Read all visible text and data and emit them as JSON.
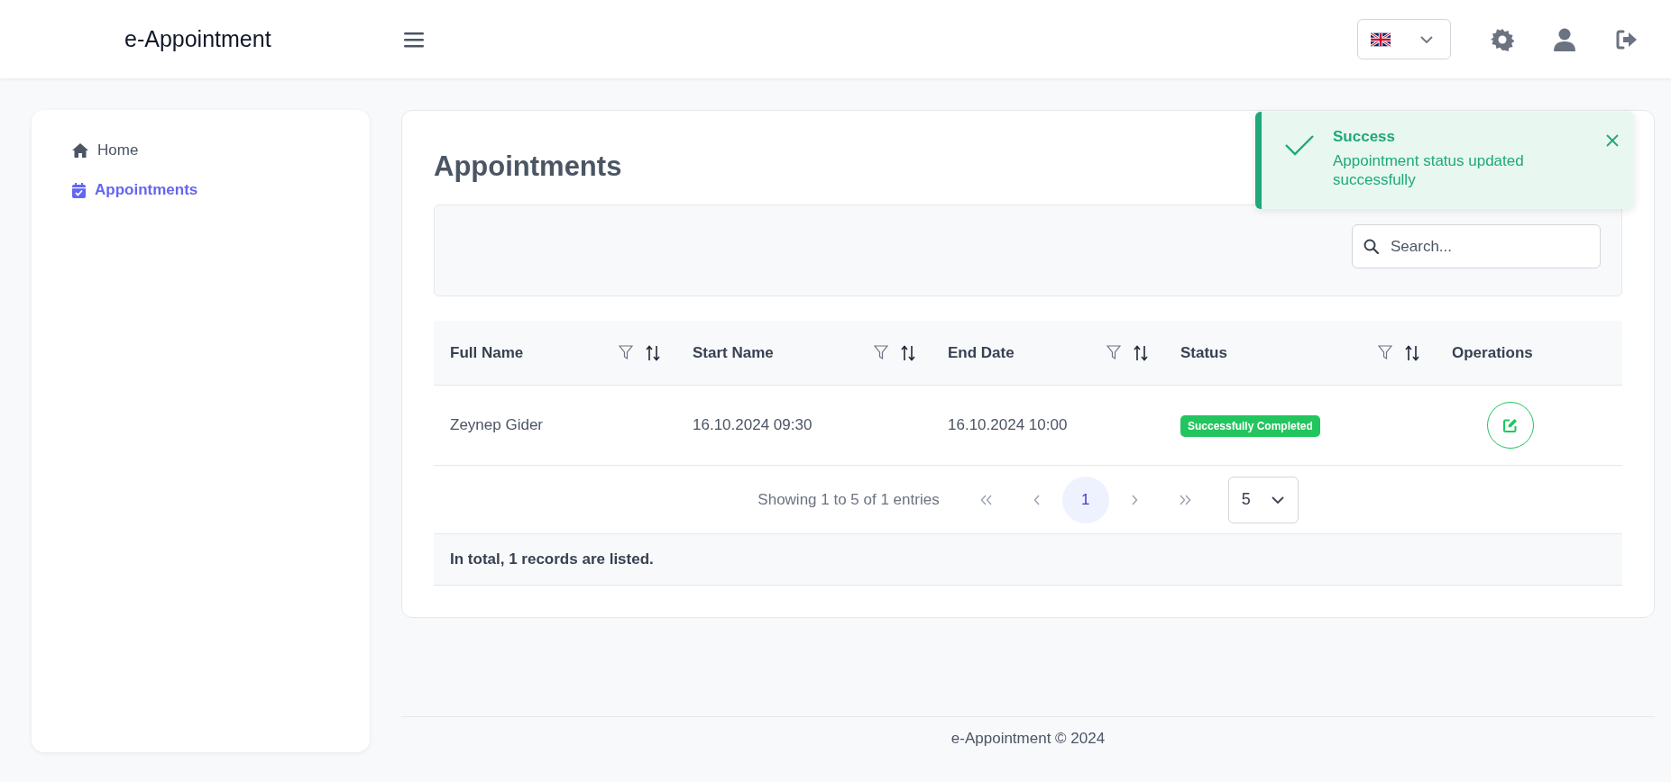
{
  "header": {
    "brand": "e-Appointment"
  },
  "sidebar": {
    "items": [
      {
        "label": "Home",
        "selected": false
      },
      {
        "label": "Appointments",
        "selected": true
      }
    ]
  },
  "page": {
    "title": "Appointments"
  },
  "search": {
    "placeholder": "Search..."
  },
  "table": {
    "columns": [
      {
        "label": "Full Name",
        "filterable": true,
        "sortable": true
      },
      {
        "label": "Start Name",
        "filterable": true,
        "sortable": true
      },
      {
        "label": "End Date",
        "filterable": true,
        "sortable": true
      },
      {
        "label": "Status",
        "filterable": true,
        "sortable": true
      },
      {
        "label": "Operations",
        "filterable": false,
        "sortable": false
      }
    ],
    "rows": [
      {
        "full_name": "Zeynep Gider",
        "start": "16.10.2024 09:30",
        "end": "16.10.2024 10:00",
        "status": "Successfully Completed"
      }
    ]
  },
  "pagination": {
    "summary": "Showing 1 to 5 of 1 entries",
    "pages": [
      {
        "label": "1",
        "selected": true
      }
    ],
    "page_size": "5"
  },
  "table_footer": "In total, 1 records are listed.",
  "footer": "e-Appointment © 2024",
  "toast": {
    "title": "Success",
    "message": "Appointment status updated successfully"
  }
}
